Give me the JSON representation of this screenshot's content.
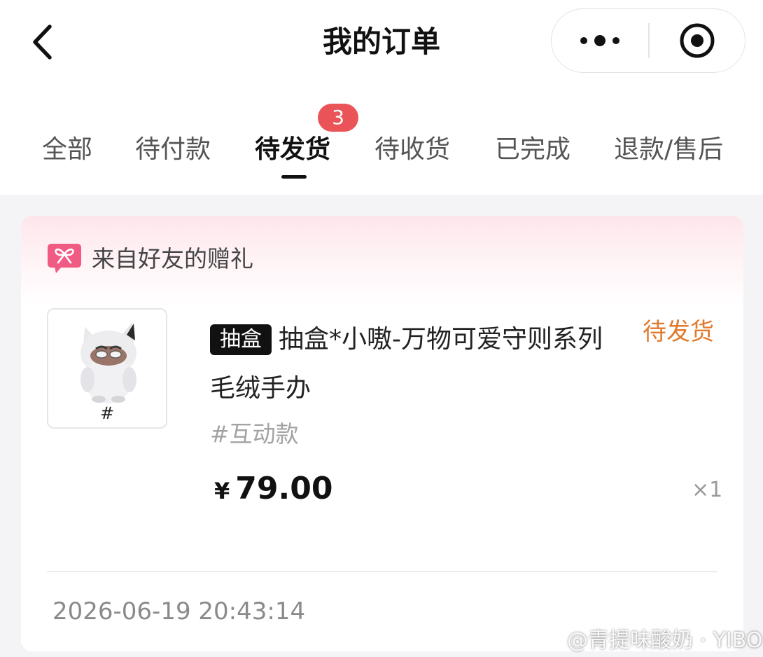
{
  "header": {
    "title": "我的订单",
    "more_icon": "more-dots-icon",
    "close_icon": "close-target-icon",
    "back_icon": "chevron-left-icon"
  },
  "tabs": [
    {
      "label": "全部",
      "active": false
    },
    {
      "label": "待付款",
      "active": false
    },
    {
      "label": "待发货",
      "active": true,
      "badge": "3"
    },
    {
      "label": "待收货",
      "active": false
    },
    {
      "label": "已完成",
      "active": false
    },
    {
      "label": "退款/售后",
      "active": false
    }
  ],
  "order": {
    "gift_label": "来自好友的赠礼",
    "gift_icon": "gift-ribbon-icon",
    "tag": "抽盒",
    "product_title": "抽盒*小嗷-万物可爱守则系列毛绒手办",
    "status": "待发货",
    "variant": "#互动款",
    "thumb_mark": "#",
    "currency": "¥",
    "price": "79.00",
    "quantity": "×1",
    "date": "2026-06-19 20:43:14"
  },
  "watermark": {
    "text": "@青提味酸奶 · YIBO",
    "icon": "weibo-icon"
  },
  "colors": {
    "accent_status": "#e07a2e",
    "badge": "#ea5357",
    "gift_pink": "#f05b84",
    "tag_bg": "#111111"
  }
}
